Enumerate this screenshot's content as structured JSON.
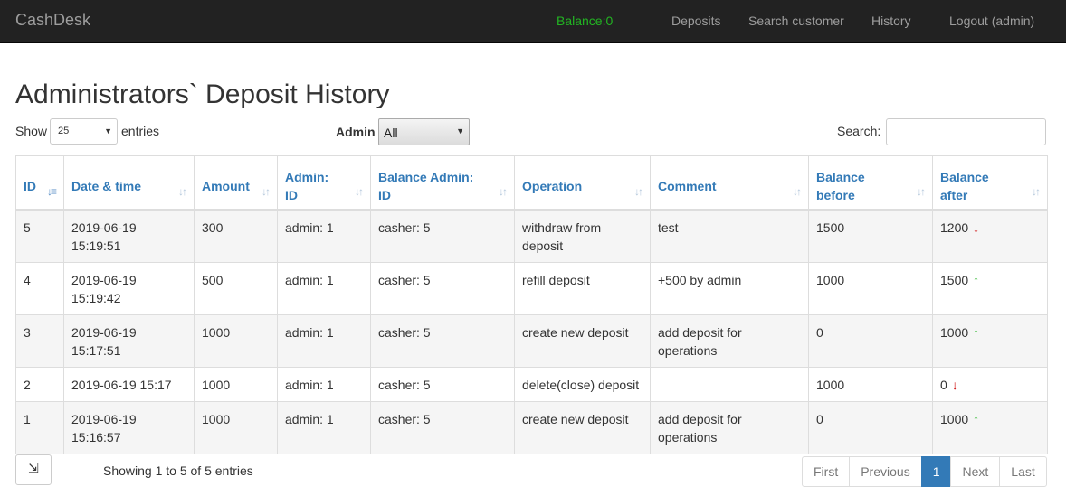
{
  "nav": {
    "brand": "CashDesk",
    "balance": "Balance:0",
    "links": [
      "Deposits",
      "Search customer",
      "History",
      "Logout (admin)"
    ]
  },
  "page": {
    "title": "Administrators` Deposit History"
  },
  "controls": {
    "show_label": "Show",
    "length_value": "25",
    "entries_label": "entries",
    "admin_label": "Admin",
    "admin_value": "All",
    "search_label": "Search:",
    "search_value": ""
  },
  "table": {
    "headers": [
      {
        "line1": "ID",
        "line2": ""
      },
      {
        "line1": "Date & time",
        "line2": ""
      },
      {
        "line1": "Amount",
        "line2": ""
      },
      {
        "line1": "Admin:",
        "line2": "ID"
      },
      {
        "line1": "Balance Admin:",
        "line2": "ID"
      },
      {
        "line1": "Operation",
        "line2": ""
      },
      {
        "line1": "Comment",
        "line2": ""
      },
      {
        "line1": "Balance",
        "line2": "before"
      },
      {
        "line1": "Balance",
        "line2": "after"
      }
    ],
    "rows": [
      {
        "id": "5",
        "date1": "2019-06-19",
        "date2": "15:19:51",
        "amount": "300",
        "admin": "admin: 1",
        "balance_admin": "casher: 5",
        "op1": "withdraw from",
        "op2": "deposit",
        "c1": "test",
        "c2": "",
        "before": "1500",
        "after": "1200",
        "dir": "down"
      },
      {
        "id": "4",
        "date1": "2019-06-19",
        "date2": "15:19:42",
        "amount": "500",
        "admin": "admin: 1",
        "balance_admin": "casher: 5",
        "op1": "refill deposit",
        "op2": "",
        "c1": "+500 by admin",
        "c2": "",
        "before": "1000",
        "after": "1500",
        "dir": "up"
      },
      {
        "id": "3",
        "date1": "2019-06-19",
        "date2": "15:17:51",
        "amount": "1000",
        "admin": "admin: 1",
        "balance_admin": "casher: 5",
        "op1": "create new deposit",
        "op2": "",
        "c1": "add deposit for",
        "c2": "operations",
        "before": "0",
        "after": "1000",
        "dir": "up"
      },
      {
        "id": "2",
        "date1": "2019-06-19 15:17",
        "date2": "",
        "amount": "1000",
        "admin": "admin: 1",
        "balance_admin": "casher: 5",
        "op1": "delete(close) deposit",
        "op2": "",
        "c1": "",
        "c2": "",
        "before": "1000",
        "after": "0",
        "dir": "down"
      },
      {
        "id": "1",
        "date1": "2019-06-19",
        "date2": "15:16:57",
        "amount": "1000",
        "admin": "admin: 1",
        "balance_admin": "casher: 5",
        "op1": "create new deposit",
        "op2": "",
        "c1": "add deposit for",
        "c2": "operations",
        "before": "0",
        "after": "1000",
        "dir": "up"
      }
    ]
  },
  "footer": {
    "export_icon": "export-icon",
    "info": "Showing 1 to 5 of 5 entries",
    "pages": [
      "First",
      "Previous",
      "1",
      "Next",
      "Last"
    ]
  },
  "colors": {
    "navbar": "#222222",
    "balance": "#22b422",
    "link": "#337ab7",
    "up": "#2db82d",
    "down": "#cc0000"
  }
}
